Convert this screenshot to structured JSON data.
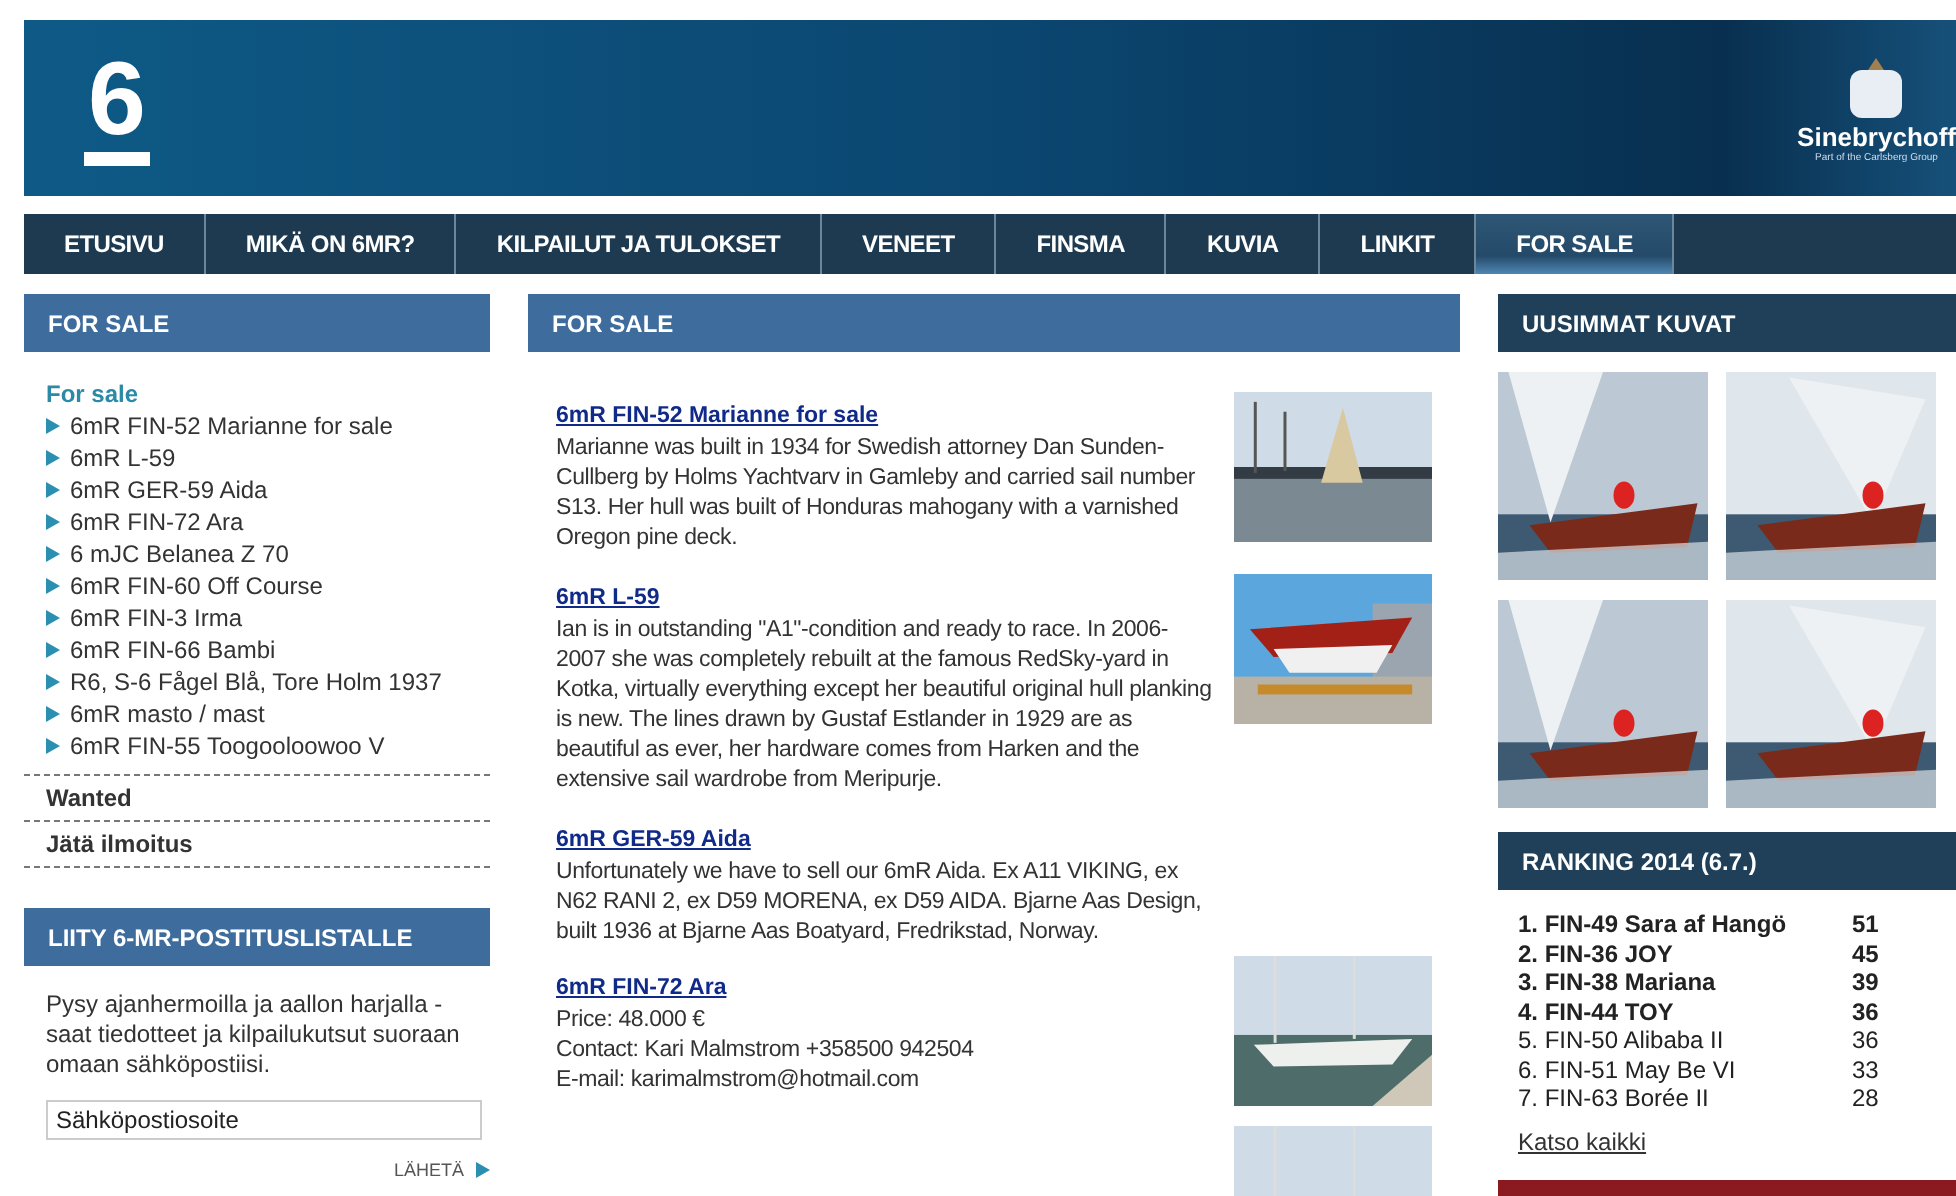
{
  "header": {
    "logo": "6",
    "sponsor": {
      "name": "Sinebrychoff",
      "tagline": "Part of the Carlsberg Group"
    }
  },
  "nav": [
    {
      "label": "ETUSIVU",
      "selected": false
    },
    {
      "label": "MIKÄ ON 6MR?",
      "selected": false
    },
    {
      "label": "KILPAILUT JA TULOKSET",
      "selected": false
    },
    {
      "label": "VENEET",
      "selected": false
    },
    {
      "label": "FINSMA",
      "selected": false
    },
    {
      "label": "KUVIA",
      "selected": false
    },
    {
      "label": "LINKIT",
      "selected": false
    },
    {
      "label": "FOR SALE",
      "selected": true
    }
  ],
  "sidebar": {
    "title": "FOR SALE",
    "section": "For sale",
    "items": [
      "6mR FIN-52 Marianne for sale",
      "6mR L-59",
      "6mR GER-59 Aida",
      "6mR FIN-72 Ara",
      "6 mJC Belanea Z 70",
      "6mR FIN-60 Off Course",
      "6mR FIN-3 Irma",
      "6mR FIN-66 Bambi",
      "R6, S-6 Fågel Blå, Tore Holm 1937",
      "6mR masto / mast",
      "6mR FIN-55 Toogooloowoo V"
    ],
    "links": [
      "Wanted",
      "Jätä ilmoitus"
    ],
    "newsletter": {
      "title": "LIITY 6-MR-POSTITUSLISTALLE",
      "text": "Pysy ajanhermoilla ja aallon harjalla - saat tiedotteet ja kilpailukutsut suoraan omaan sähköpostiisi.",
      "placeholder": "Sähköpostiosoite",
      "submit": "LÄHETÄ"
    }
  },
  "main": {
    "title": "FOR SALE",
    "articles": [
      {
        "title": "6mR FIN-52 Marianne for sale",
        "lines": [
          "Marianne was built in 1934 for Swedish attorney Dan Sunden-Cullberg by Holms Yachtvarv in Gamleby and carried sail number S13. Her hull was built of Honduras mahogany with a varnished Oregon pine deck."
        ],
        "picture": {
          "kind": "picture"
        }
      },
      {
        "title": "6mR L-59",
        "lines": [
          "Ian is in outstanding \"A1\"-condition and ready to race. In 2006-2007 she was completely rebuilt at the famous RedSky-yard in Kotka, virtually everything except her beautiful original hull planking is new. The lines drawn by Gustaf Estlander in 1929 are as beautiful as ever, her hardware comes from Harken and the extensive sail wardrobe from Meripurje."
        ],
        "picture": {
          "kind": "picture"
        }
      },
      {
        "title": "6mR GER-59 Aida",
        "lines": [
          "Unfortunately we have to sell our 6mR Aida. Ex A11 VIKING, ex N62 RANI 2, ex D59 MORENA, ex D59 AIDA. Bjarne Aas Design, built 1936 at Bjarne Aas Boatyard, Fredrikstad, Norway."
        ]
      },
      {
        "title": "6mR FIN-72 Ara",
        "lines": [
          "Price: 48.000 €",
          "Contact: Kari Malmstrom +358500 942504",
          "E-mail: karimalmstrom@hotmail.com"
        ],
        "picture": {
          "kind": "picture"
        }
      },
      {
        "picture": {
          "kind": "picture"
        }
      }
    ]
  },
  "gallery": {
    "title": "UUSIMMAT KUVAT",
    "pictures": [
      {
        "kind": "picture"
      },
      {
        "kind": "picture"
      },
      {
        "kind": "picture"
      },
      {
        "kind": "picture"
      }
    ]
  },
  "ranking": {
    "title": "RANKING 2014 (6.7.)",
    "rows": [
      {
        "name": "1. FIN-49 Sara af Hangö",
        "points": "51",
        "bold": true
      },
      {
        "name": "2. FIN-36 JOY",
        "points": "45",
        "bold": true
      },
      {
        "name": "3. FIN-38 Mariana",
        "points": "39",
        "bold": true
      },
      {
        "name": "4. FIN-44 TOY",
        "points": "36",
        "bold": true
      },
      {
        "name": "5. FIN-50 Alibaba II",
        "points": "36",
        "bold": false
      },
      {
        "name": "6. FIN-51 May Be VI",
        "points": "33",
        "bold": false
      },
      {
        "name": "7. FIN-63 Borée II",
        "points": "28",
        "bold": false
      }
    ],
    "more": "Katso kaikki"
  }
}
